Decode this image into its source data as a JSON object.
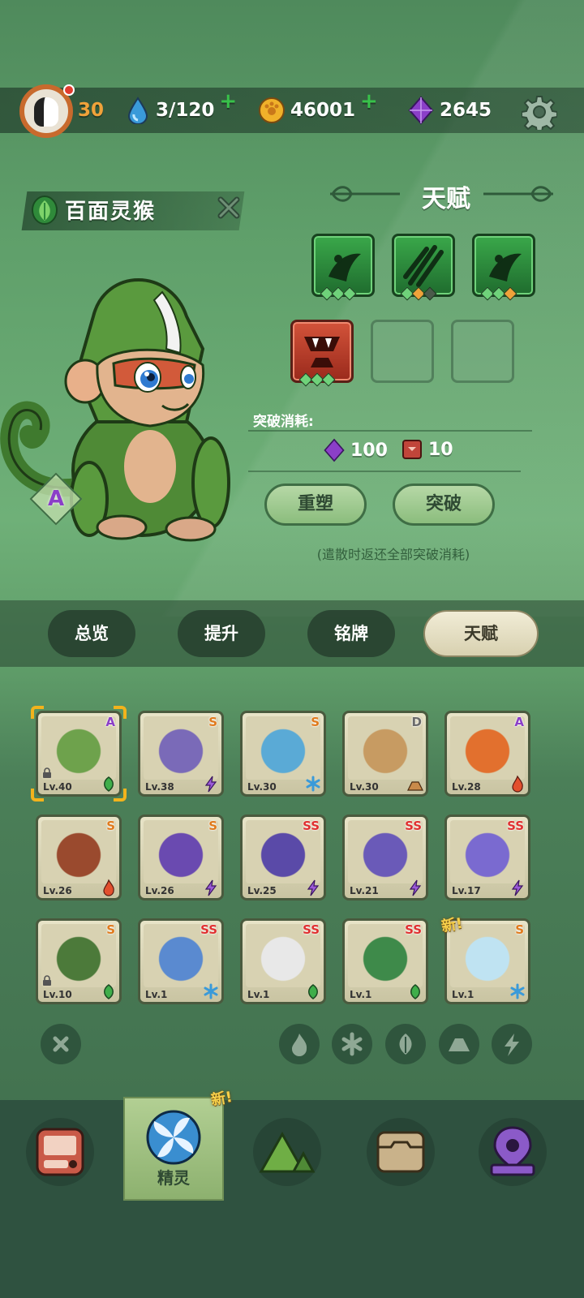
{
  "resources": {
    "level": "30",
    "stamina": "3/120",
    "coins": "46001",
    "gems": "2645"
  },
  "pet": {
    "name": "百面灵猴",
    "grade": "A"
  },
  "talent": {
    "title": "天赋",
    "cost_label": "突破消耗:",
    "cost_gems": "100",
    "cost_items": "10",
    "reset_label": "重塑",
    "breakthrough_label": "突破",
    "note": "(遣散时返还全部突破消耗)"
  },
  "tabs": [
    "总览",
    "提升",
    "铭牌",
    "天赋"
  ],
  "active_tab": "天赋",
  "roster": [
    {
      "level": "Lv.40",
      "rank": "A",
      "element": "leaf",
      "rank_color": "#8b3fc8",
      "art": "#6ea24c"
    },
    {
      "level": "Lv.38",
      "rank": "S",
      "element": "lightning",
      "rank_color": "#e07a1c",
      "art": "#7a6ab8"
    },
    {
      "level": "Lv.30",
      "rank": "S",
      "element": "snow",
      "rank_color": "#e07a1c",
      "art": "#5aaad6"
    },
    {
      "level": "Lv.30",
      "rank": "D",
      "element": "earth",
      "rank_color": "#6a6a6a",
      "art": "#c79b62"
    },
    {
      "level": "Lv.28",
      "rank": "A",
      "element": "fire",
      "rank_color": "#8b3fc8",
      "art": "#e2702e"
    },
    {
      "level": "Lv.26",
      "rank": "S",
      "element": "fire",
      "rank_color": "#e07a1c",
      "art": "#9a4a2e"
    },
    {
      "level": "Lv.26",
      "rank": "S",
      "element": "lightning",
      "rank_color": "#e07a1c",
      "art": "#6a4ab0"
    },
    {
      "level": "Lv.25",
      "rank": "SS",
      "element": "lightning",
      "rank_color": "#e03030",
      "art": "#5a4aa8"
    },
    {
      "level": "Lv.21",
      "rank": "SS",
      "element": "lightning",
      "rank_color": "#e03030",
      "art": "#6a5ab8"
    },
    {
      "level": "Lv.17",
      "rank": "SS",
      "element": "lightning",
      "rank_color": "#e03030",
      "art": "#7a6ad0"
    },
    {
      "level": "Lv.10",
      "rank": "S",
      "element": "leaf",
      "rank_color": "#e07a1c",
      "art": "#4c7a3a"
    },
    {
      "level": "Lv.1",
      "rank": "SS",
      "element": "snow",
      "rank_color": "#e03030",
      "art": "#5a8ad0"
    },
    {
      "level": "Lv.1",
      "rank": "SS",
      "element": "leaf",
      "rank_color": "#e03030",
      "art": "#e8e8e8"
    },
    {
      "level": "Lv.1",
      "rank": "SS",
      "element": "leaf",
      "rank_color": "#e03030",
      "art": "#3e8a4a"
    },
    {
      "level": "Lv.1",
      "rank": "S",
      "element": "snow",
      "rank_color": "#e07a1c",
      "art": "#bfe3f2"
    }
  ],
  "new_badge": "新!",
  "nav": {
    "active_label": "精灵"
  },
  "colors": {
    "accent_green": "#38c24a",
    "gem_purple": "#8b3fc8",
    "coin_gold": "#f0b12a"
  }
}
